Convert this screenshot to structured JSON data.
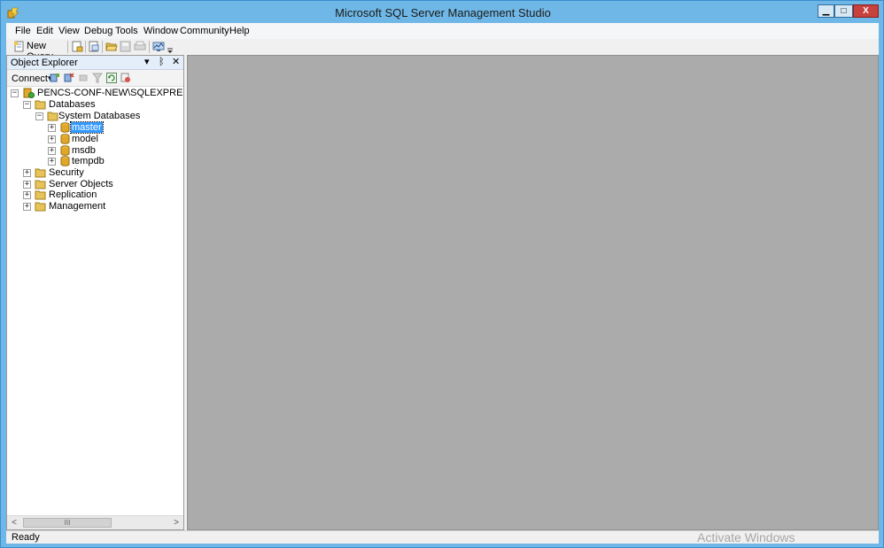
{
  "window": {
    "title": "Microsoft SQL Server Management Studio",
    "minimize_label": "▁",
    "maximize_label": "□",
    "close_label": "X"
  },
  "menu": [
    "File",
    "Edit",
    "View",
    "Debug",
    "Tools",
    "Window",
    "Community",
    "Help"
  ],
  "toolbar": {
    "new_query_label": "New Query",
    "icons": [
      "new-query-icon",
      "new-file-icon",
      "new-project-icon",
      "open-folder-icon",
      "save-icon",
      "print-icon",
      "activity-monitor-icon",
      "toolbar-options-icon"
    ]
  },
  "object_explorer": {
    "title": "Object Explorer",
    "connect_label": "Connect",
    "dropdown_glyph": "▾",
    "pin_glyph": "ᛒ",
    "close_glyph": "✕",
    "toolbar_icons": [
      "connect-object-explorer-icon",
      "disconnect-icon",
      "stop-icon",
      "filter-icon",
      "refresh-icon",
      "sync-icon"
    ],
    "tree": {
      "server": "PENCS-CONF-NEW\\SQLEXPRESS (SQL Server",
      "databases": "Databases",
      "system_databases": "System Databases",
      "db_master": "master",
      "db_model": "model",
      "db_msdb": "msdb",
      "db_tempdb": "tempdb",
      "security": "Security",
      "server_objects": "Server Objects",
      "replication": "Replication",
      "management": "Management"
    },
    "expanded_glyph": "−",
    "collapsed_glyph": "+",
    "scroll_left": "<",
    "scroll_right": ">",
    "scroll_grip": "III"
  },
  "status": {
    "text": "Ready"
  },
  "watermark": "Activate Windows",
  "colors": {
    "title_bar": "#6fb7e6",
    "mdi_background": "#ababab",
    "selection": "#3399ff",
    "close_button": "#c7413d",
    "folder": "#e8c35a",
    "database": "#e0a72a"
  }
}
